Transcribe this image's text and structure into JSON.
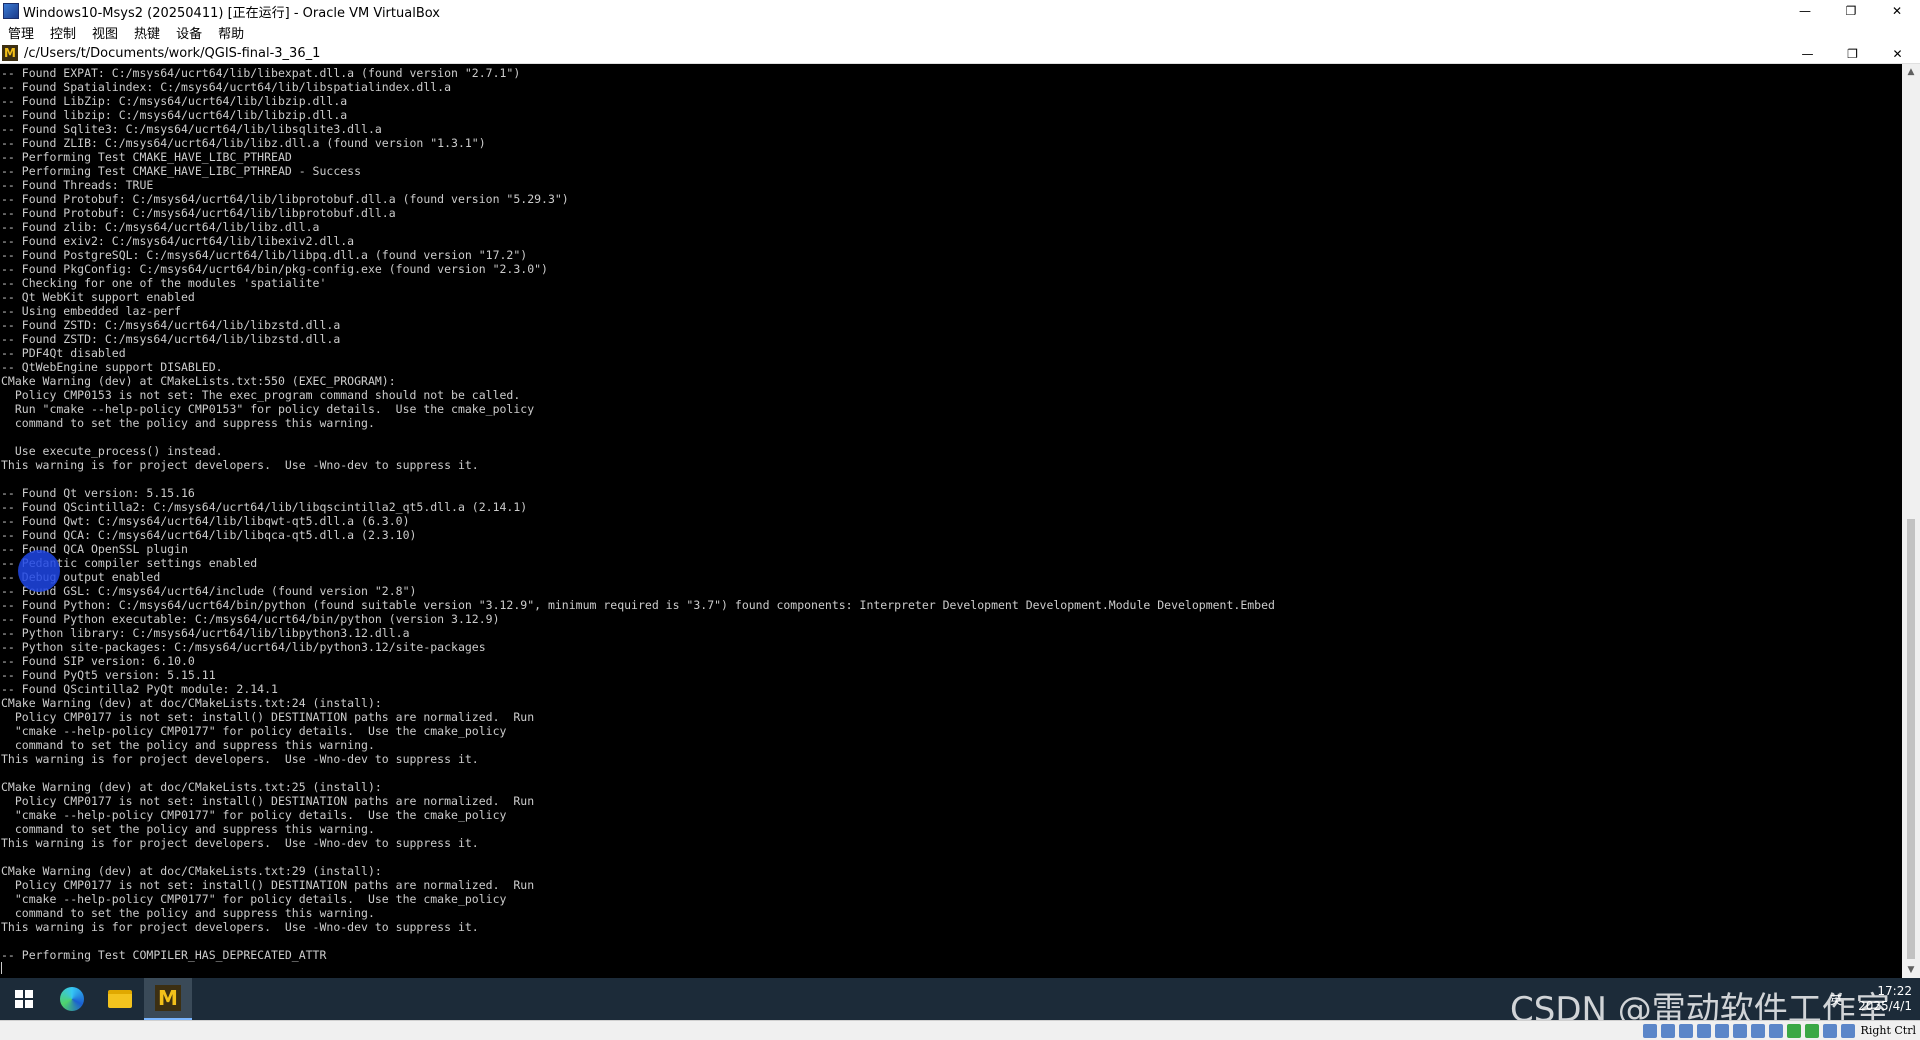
{
  "window": {
    "title": "Windows10-Msys2 (20250411) [正在运行] - Oracle VM VirtualBox",
    "minimize": "—",
    "maximize": "❐",
    "close": "✕"
  },
  "menu": {
    "items": [
      "管理",
      "控制",
      "视图",
      "热键",
      "设备",
      "帮助"
    ]
  },
  "guest_window": {
    "title": "/c/Users/t/Documents/work/QGIS-final-3_36_1",
    "icon_letter": "M"
  },
  "terminal": {
    "lines": [
      "-- Found EXPAT: C:/msys64/ucrt64/lib/libexpat.dll.a (found version \"2.7.1\")",
      "-- Found Spatialindex: C:/msys64/ucrt64/lib/libspatialindex.dll.a",
      "-- Found LibZip: C:/msys64/ucrt64/lib/libzip.dll.a",
      "-- Found libzip: C:/msys64/ucrt64/lib/libzip.dll.a",
      "-- Found Sqlite3: C:/msys64/ucrt64/lib/libsqlite3.dll.a",
      "-- Found ZLIB: C:/msys64/ucrt64/lib/libz.dll.a (found version \"1.3.1\")",
      "-- Performing Test CMAKE_HAVE_LIBC_PTHREAD",
      "-- Performing Test CMAKE_HAVE_LIBC_PTHREAD - Success",
      "-- Found Threads: TRUE",
      "-- Found Protobuf: C:/msys64/ucrt64/lib/libprotobuf.dll.a (found version \"5.29.3\")",
      "-- Found Protobuf: C:/msys64/ucrt64/lib/libprotobuf.dll.a",
      "-- Found zlib: C:/msys64/ucrt64/lib/libz.dll.a",
      "-- Found exiv2: C:/msys64/ucrt64/lib/libexiv2.dll.a",
      "-- Found PostgreSQL: C:/msys64/ucrt64/lib/libpq.dll.a (found version \"17.2\")",
      "-- Found PkgConfig: C:/msys64/ucrt64/bin/pkg-config.exe (found version \"2.3.0\")",
      "-- Checking for one of the modules 'spatialite'",
      "-- Qt WebKit support enabled",
      "-- Using embedded laz-perf",
      "-- Found ZSTD: C:/msys64/ucrt64/lib/libzstd.dll.a",
      "-- Found ZSTD: C:/msys64/ucrt64/lib/libzstd.dll.a",
      "-- PDF4Qt disabled",
      "-- QtWebEngine support DISABLED.",
      "CMake Warning (dev) at CMakeLists.txt:550 (EXEC_PROGRAM):",
      "  Policy CMP0153 is not set: The exec_program command should not be called.",
      "  Run \"cmake --help-policy CMP0153\" for policy details.  Use the cmake_policy",
      "  command to set the policy and suppress this warning.",
      "",
      "  Use execute_process() instead.",
      "This warning is for project developers.  Use -Wno-dev to suppress it.",
      "",
      "-- Found Qt version: 5.15.16",
      "-- Found QScintilla2: C:/msys64/ucrt64/lib/libqscintilla2_qt5.dll.a (2.14.1)",
      "-- Found Qwt: C:/msys64/ucrt64/lib/libqwt-qt5.dll.a (6.3.0)",
      "-- Found QCA: C:/msys64/ucrt64/lib/libqca-qt5.dll.a (2.3.10)",
      "-- Found QCA OpenSSL plugin",
      "-- Pedantic compiler settings enabled",
      "-- Debug output enabled",
      "-- Found GSL: C:/msys64/ucrt64/include (found version \"2.8\")",
      "-- Found Python: C:/msys64/ucrt64/bin/python (found suitable version \"3.12.9\", minimum required is \"3.7\") found components: Interpreter Development Development.Module Development.Embed",
      "-- Found Python executable: C:/msys64/ucrt64/bin/python (version 3.12.9)",
      "-- Python library: C:/msys64/ucrt64/lib/libpython3.12.dll.a",
      "-- Python site-packages: C:/msys64/ucrt64/lib/python3.12/site-packages",
      "-- Found SIP version: 6.10.0",
      "-- Found PyQt5 version: 5.15.11",
      "-- Found QScintilla2 PyQt module: 2.14.1",
      "CMake Warning (dev) at doc/CMakeLists.txt:24 (install):",
      "  Policy CMP0177 is not set: install() DESTINATION paths are normalized.  Run",
      "  \"cmake --help-policy CMP0177\" for policy details.  Use the cmake_policy",
      "  command to set the policy and suppress this warning.",
      "This warning is for project developers.  Use -Wno-dev to suppress it.",
      "",
      "CMake Warning (dev) at doc/CMakeLists.txt:25 (install):",
      "  Policy CMP0177 is not set: install() DESTINATION paths are normalized.  Run",
      "  \"cmake --help-policy CMP0177\" for policy details.  Use the cmake_policy",
      "  command to set the policy and suppress this warning.",
      "This warning is for project developers.  Use -Wno-dev to suppress it.",
      "",
      "CMake Warning (dev) at doc/CMakeLists.txt:29 (install):",
      "  Policy CMP0177 is not set: install() DESTINATION paths are normalized.  Run",
      "  \"cmake --help-policy CMP0177\" for policy details.  Use the cmake_policy",
      "  command to set the policy and suppress this warning.",
      "This warning is for project developers.  Use -Wno-dev to suppress it.",
      "",
      "-- Performing Test COMPILER_HAS_DEPRECATED_ATTR"
    ]
  },
  "taskbar": {
    "ime": "英",
    "time": "17:22",
    "date": "2025/4/1"
  },
  "watermark": "CSDN @雷动软件工作室",
  "statusbar": {
    "host_key": "Right Ctrl"
  },
  "colors": {
    "terminal_bg": "#000000",
    "terminal_fg": "#cccccc",
    "taskbar_bg": "#1c2b39"
  }
}
